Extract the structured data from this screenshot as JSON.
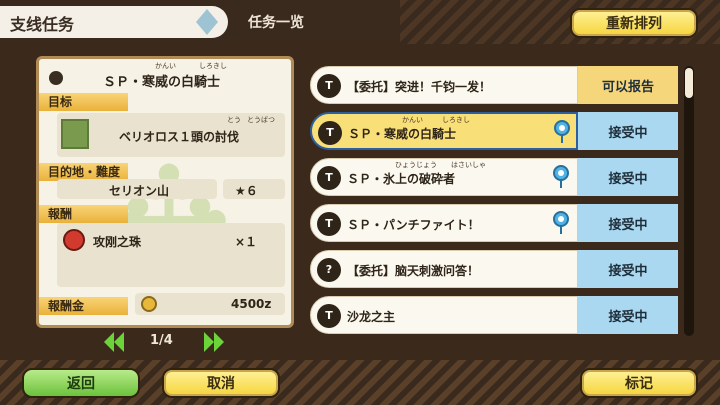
{
  "header": {
    "section_title": "支线任务",
    "list_title": "任务一览",
    "resort_label": "重新排列"
  },
  "detail": {
    "quest_name": "ＳＰ・寒威の白騎士",
    "quest_ruby_1": "かんい",
    "quest_ruby_2": "しろきし",
    "target_label": "目标",
    "target_text": "ベリオロス１頭の討伐",
    "target_ruby_1": "とう",
    "target_ruby_2": "とうばつ",
    "destination_label": "目的地・難度",
    "destination": "セリオン山",
    "difficulty": "★６",
    "reward_label": "報酬",
    "reward_item": "攻刚之珠",
    "reward_qty": "×１",
    "money_label": "報酬金",
    "money": "4500z"
  },
  "pagination": {
    "text": "1/4"
  },
  "quests": [
    {
      "icon": "quest",
      "name": "【委托】突进！千钧一发！",
      "status": "可以报告",
      "pin": false,
      "selected": false,
      "ruby_1": "",
      "ruby_2": ""
    },
    {
      "icon": "quest",
      "name": "ＳＰ・寒威の白騎士",
      "status": "接受中",
      "pin": true,
      "selected": true,
      "ruby_1": "かんい",
      "ruby_2": "しろきし"
    },
    {
      "icon": "quest",
      "name": "ＳＰ・氷上の破砕者",
      "status": "接受中",
      "pin": true,
      "selected": false,
      "ruby_1": "ひょうじょう",
      "ruby_2": "はさいしゃ"
    },
    {
      "icon": "quest",
      "name": "ＳＰ・パンチファイト！",
      "status": "接受中",
      "pin": true,
      "selected": false,
      "ruby_1": "",
      "ruby_2": ""
    },
    {
      "icon": "question",
      "name": "【委托】脑天刺激问答！",
      "status": "接受中",
      "pin": false,
      "selected": false,
      "ruby_1": "",
      "ruby_2": ""
    },
    {
      "icon": "quest",
      "name": "沙龙之主",
      "status": "接受中",
      "pin": false,
      "selected": false,
      "ruby_1": "",
      "ruby_2": ""
    }
  ],
  "footer": {
    "back_label": "返回",
    "cancel_label": "取消",
    "mark_label": "标记"
  }
}
